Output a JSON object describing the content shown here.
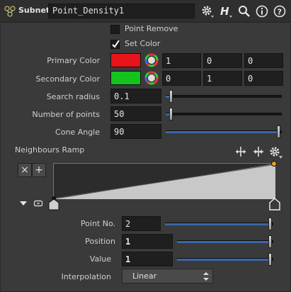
{
  "header": {
    "node_type": "Subnet",
    "node_name": "Point_Density1"
  },
  "params": {
    "point_remove": {
      "label": "Point Remove",
      "checked": false
    },
    "set_color": {
      "label": "Set Color",
      "checked": true
    },
    "primary_color": {
      "label": "Primary Color",
      "swatch": "#e8141c",
      "r": "1",
      "g": "0",
      "b": "0"
    },
    "secondary_color": {
      "label": "Secondary Color",
      "swatch": "#14c31e",
      "r": "0",
      "g": "1",
      "b": "0"
    },
    "search_radius": {
      "label": "Search radius",
      "value": "0.1",
      "slider": 0.05
    },
    "num_points": {
      "label": "Number of points",
      "value": "50",
      "slider": 0.05
    },
    "cone_angle": {
      "label": "Cone Angle",
      "value": "90",
      "slider": 1.0
    }
  },
  "ramp": {
    "label": "Neighbours Ramp",
    "remove_label": "×",
    "add_label": "+",
    "point_no": {
      "label": "Point No.",
      "value": "2",
      "slider": 1.0
    },
    "position": {
      "label": "Position",
      "value": "1",
      "slider": 1.0
    },
    "value": {
      "label": "Value",
      "value": "1",
      "slider": 1.0
    },
    "interpolation": {
      "label": "Interpolation",
      "selected": "Linear"
    }
  },
  "colors": {
    "accent": "#3a67a8",
    "panel": "#3a3a3a",
    "ramp_fill": "#c8c8c8",
    "key_handle": "#e8a020"
  }
}
